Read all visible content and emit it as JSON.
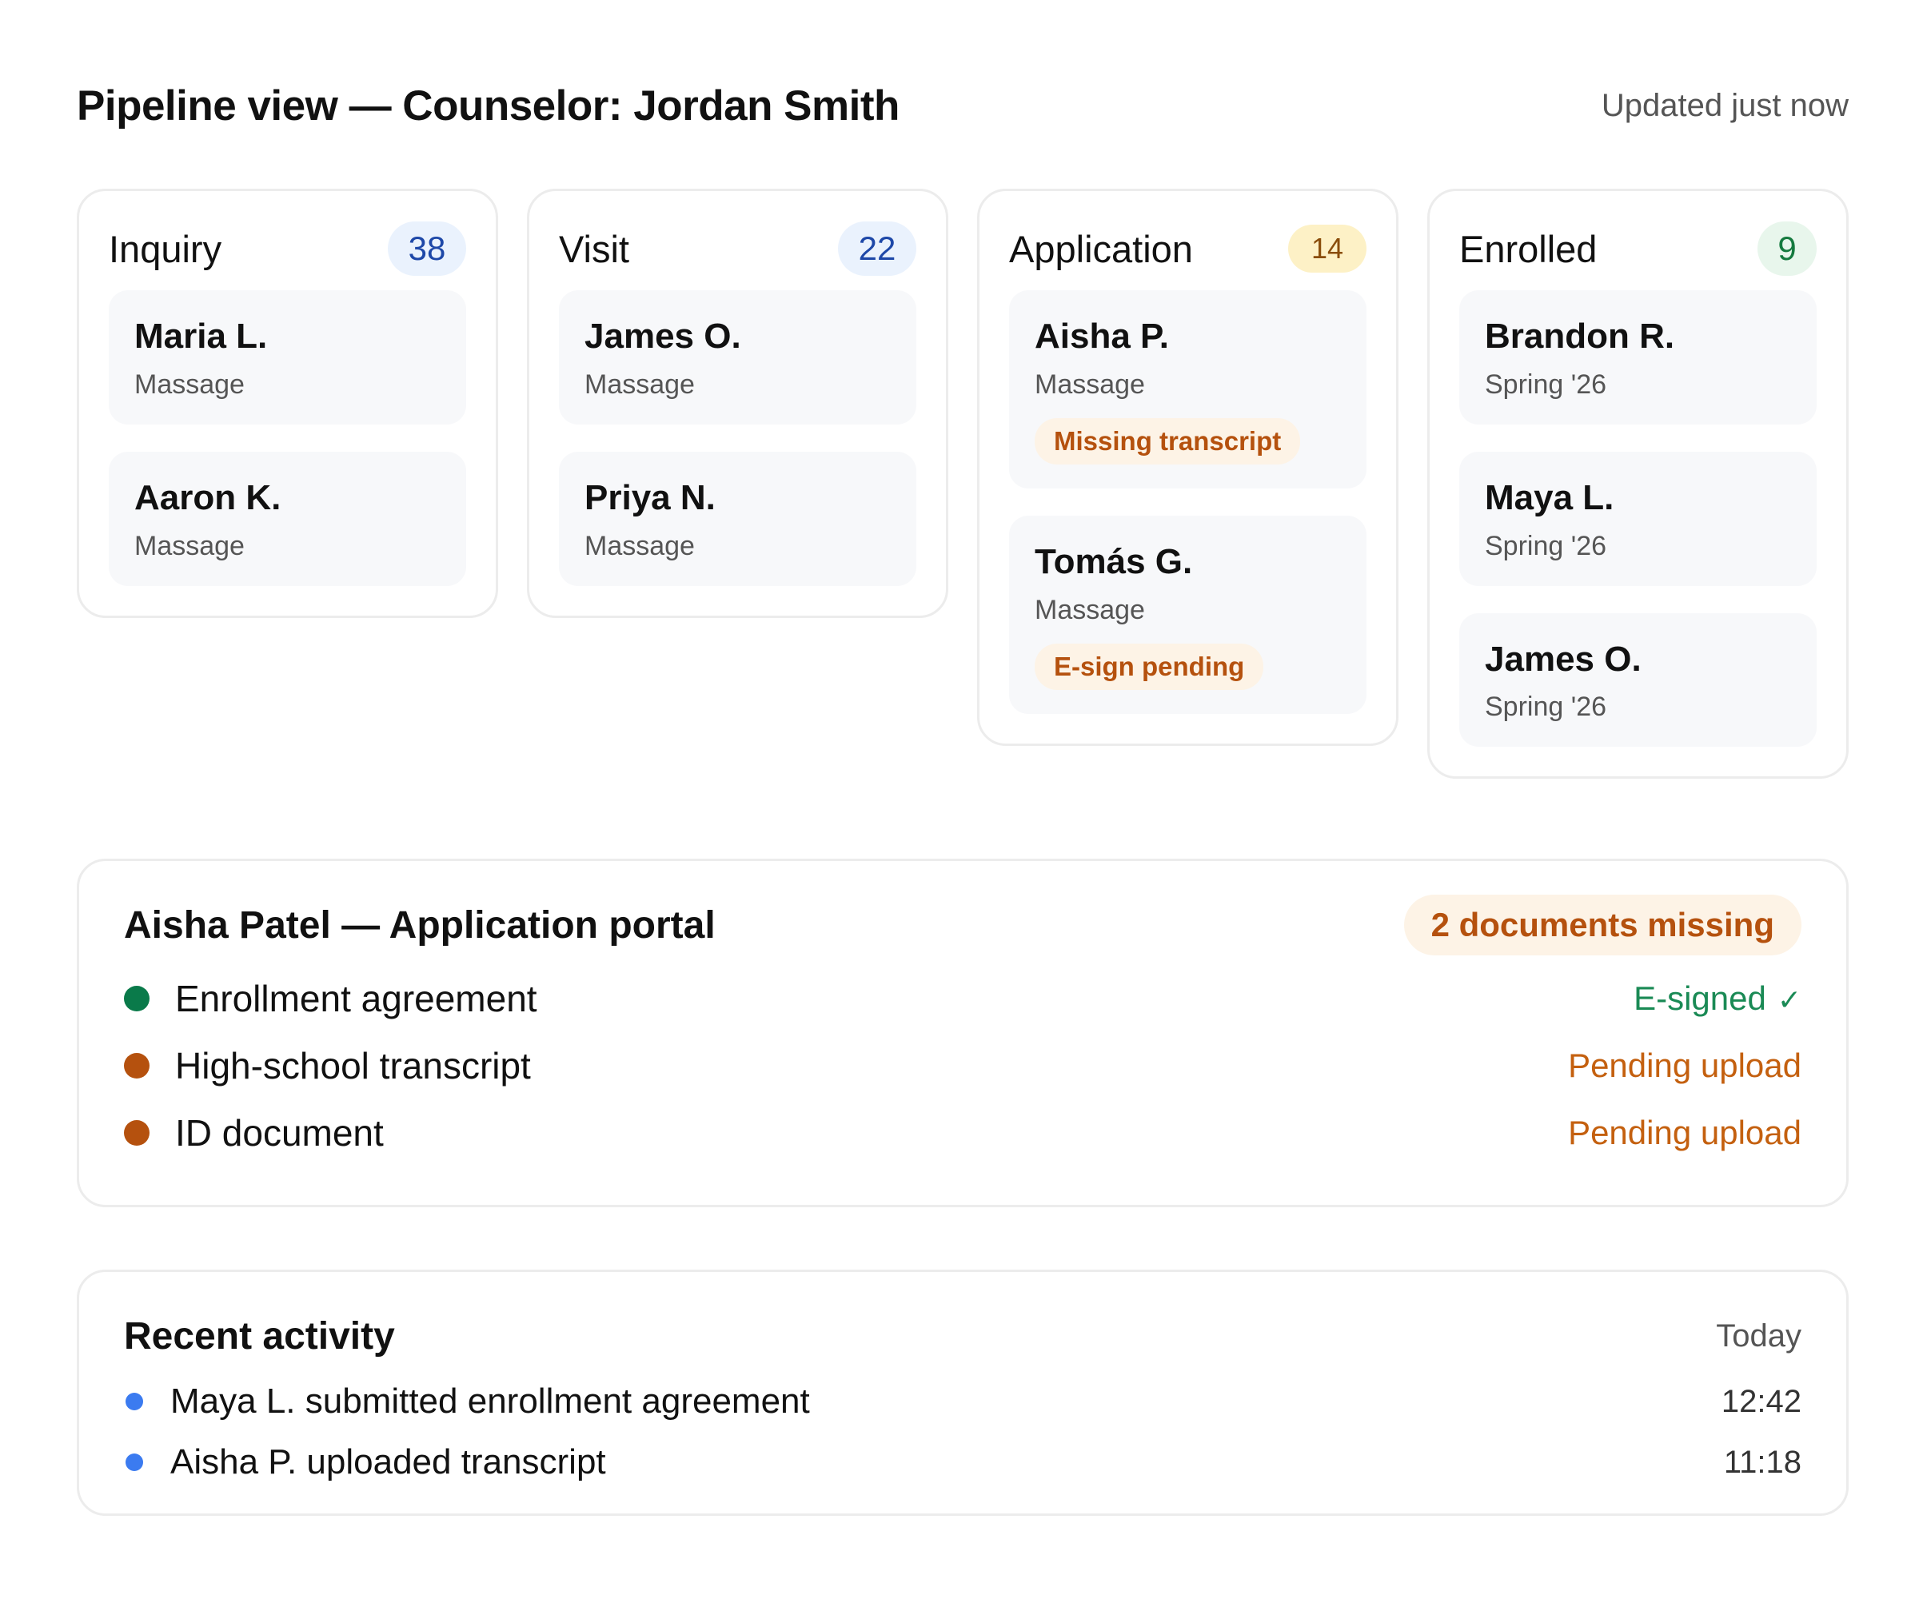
{
  "header": {
    "title": "Pipeline view — Counselor: Jordan Smith",
    "updated": "Updated just now"
  },
  "columns": [
    {
      "title": "Inquiry",
      "count": "38",
      "cards": [
        {
          "name": "Maria L.",
          "sub": "Massage"
        },
        {
          "name": "Aaron K.",
          "sub": "Massage"
        }
      ]
    },
    {
      "title": "Visit",
      "count": "22",
      "cards": [
        {
          "name": "James O.",
          "sub": "Massage"
        },
        {
          "name": "Priya N.",
          "sub": "Massage"
        }
      ]
    },
    {
      "title": "Application",
      "count": "14",
      "cards": [
        {
          "name": "Aisha P.",
          "sub": "Massage",
          "tag": "Missing transcript"
        },
        {
          "name": "Tomás G.",
          "sub": "Massage",
          "tag": "E-sign pending"
        }
      ]
    },
    {
      "title": "Enrolled",
      "count": "9",
      "cards": [
        {
          "name": "Brandon R.",
          "sub": "Spring '26"
        },
        {
          "name": "Maya L.",
          "sub": "Spring '26"
        },
        {
          "name": "James O.",
          "sub": "Spring '26"
        }
      ]
    }
  ],
  "portal": {
    "title": "Aisha Patel — Application portal",
    "badge": "2 documents missing",
    "documents": [
      {
        "name": "Enrollment agreement",
        "status": "E-signed",
        "state": "done"
      },
      {
        "name": "High-school transcript",
        "status": "Pending upload",
        "state": "pending"
      },
      {
        "name": "ID document",
        "status": "Pending upload",
        "state": "pending"
      }
    ]
  },
  "activity": {
    "title": "Recent activity",
    "day": "Today",
    "items": [
      {
        "text": "Maya L. submitted enrollment agreement",
        "time": "12:42"
      },
      {
        "text": "Aisha P. uploaded transcript",
        "time": "11:18"
      }
    ]
  },
  "colors": {
    "blue_badge_bg": "#eaf2fd",
    "blue_badge_text": "#1e48a8",
    "amber_badge_bg": "#fdf1c6",
    "green_badge_bg": "#e8f6ec",
    "warning_text": "#b5510e",
    "success_text": "#1a8a55",
    "activity_dot": "#3b7bf0"
  }
}
